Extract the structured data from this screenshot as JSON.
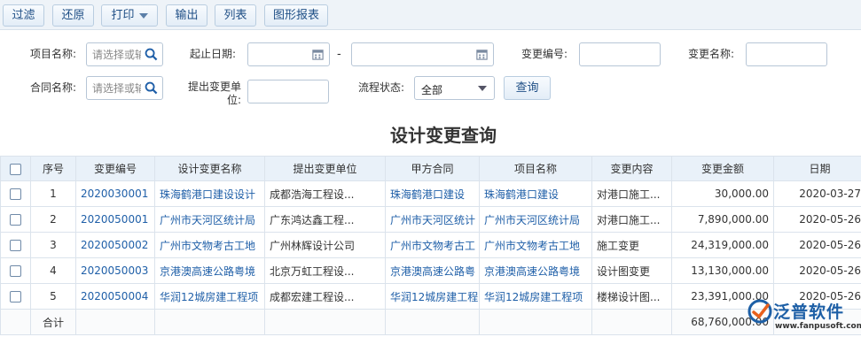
{
  "toolbar": {
    "filter": "过滤",
    "reset": "还原",
    "print": "打印",
    "export": "输出",
    "columns": "列表",
    "chart_report": "图形报表"
  },
  "filters": {
    "project_name_label": "项目名称:",
    "project_name_placeholder": "请选择或输入",
    "date_range_label": "起止日期:",
    "date_separator": "-",
    "change_no_label": "变更编号:",
    "change_name_label": "变更名称:",
    "contract_name_label": "合同名称:",
    "contract_name_placeholder": "请选择或输入",
    "submit_unit_label": "提出变更单位:",
    "flow_status_label": "流程状态:",
    "flow_status_value": "全部",
    "query_button": "查询"
  },
  "page_title": "设计变更查询",
  "table": {
    "headers": [
      "序号",
      "变更编号",
      "设计变更名称",
      "提出变更单位",
      "甲方合同",
      "项目名称",
      "变更内容",
      "变更金额",
      "日期"
    ],
    "rows": [
      {
        "no": "1",
        "code": "2020030001",
        "name": "珠海鹤港口建设设计",
        "unit": "成都浩海工程设...",
        "contract": "珠海鹤港口建设",
        "project": "珠海鹤港口建设",
        "content": "对港口施工...",
        "amount": "30,000.00",
        "date": "2020-03-27"
      },
      {
        "no": "2",
        "code": "2020050001",
        "name": "广州市天河区统计局",
        "unit": "广东鸿达鑫工程...",
        "contract": "广州市天河区统计",
        "project": "广州市天河区统计局",
        "content": "对港口施工...",
        "amount": "7,890,000.00",
        "date": "2020-05-26"
      },
      {
        "no": "3",
        "code": "2020050002",
        "name": "广州市文物考古工地",
        "unit": "广州林辉设计公司",
        "contract": "广州市文物考古工",
        "project": "广州市文物考古工地",
        "content": "施工变更",
        "amount": "24,319,000.00",
        "date": "2020-05-26"
      },
      {
        "no": "4",
        "code": "2020050003",
        "name": "京港澳高速公路粤境",
        "unit": "北京万虹工程设...",
        "contract": "京港澳高速公路粤",
        "project": "京港澳高速公路粤境",
        "content": "设计图变更",
        "amount": "13,130,000.00",
        "date": "2020-05-26"
      },
      {
        "no": "5",
        "code": "2020050004",
        "name": "华润12城房建工程项",
        "unit": "成都宏建工程设...",
        "contract": "华润12城房建工程",
        "project": "华润12城房建工程项",
        "content": "楼梯设计图...",
        "amount": "23,391,000.00",
        "date": "2020-05-26"
      }
    ],
    "total_label": "合计",
    "total_amount": "68,760,000.00"
  },
  "logo": {
    "brand": "泛普软件",
    "url": "www.fanpusoft.com"
  },
  "colors": {
    "link": "#1f5fa8",
    "header_bg": "#e9f1f9",
    "toolbar_bg": "#eef3f8"
  }
}
